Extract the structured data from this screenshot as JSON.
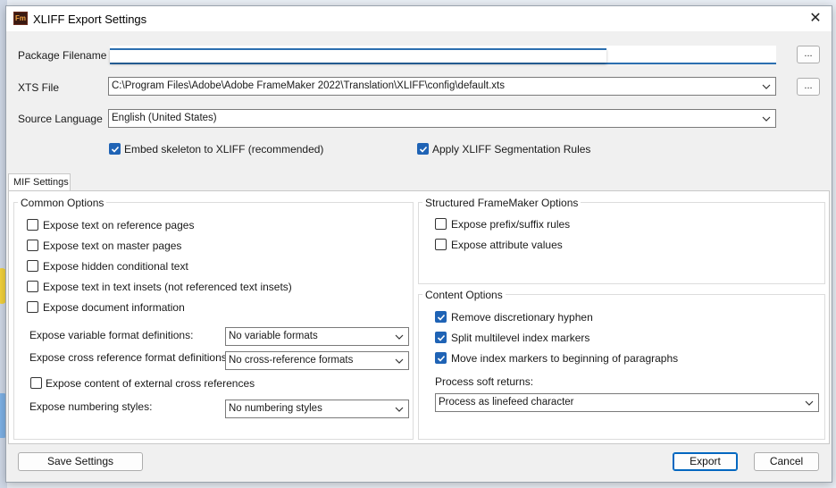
{
  "dialog": {
    "title": "XLIFF Export Settings",
    "app_icon_text": "Fm",
    "close_symbol": "✕"
  },
  "top": {
    "package_label": "Package Filename",
    "package_value": "",
    "xts_label": "XTS File",
    "xts_value": "C:\\Program Files\\Adobe\\Adobe FrameMaker 2022\\Translation\\XLIFF\\config\\default.xts",
    "source_lang_label": "Source Language",
    "source_lang_value": "English (United States)",
    "browse_label": "...",
    "embed_skeleton": {
      "label": "Embed skeleton to XLIFF (recommended)",
      "checked": true
    },
    "apply_segmentation": {
      "label": "Apply XLIFF Segmentation Rules",
      "checked": true
    }
  },
  "tab": {
    "label": "MIF Settings"
  },
  "common_options": {
    "title": "Common Options",
    "checks": [
      {
        "label": "Expose text on reference pages",
        "checked": false
      },
      {
        "label": "Expose text on master pages",
        "checked": false
      },
      {
        "label": "Expose hidden conditional text",
        "checked": false
      },
      {
        "label": "Expose text in text insets (not referenced text insets)",
        "checked": false
      },
      {
        "label": "Expose document information",
        "checked": false
      }
    ],
    "variable_formats_label": "Expose variable format definitions:",
    "variable_formats_value": "No variable formats",
    "xref_formats_label": "Expose cross reference format definitions:",
    "xref_formats_value": "No cross-reference formats",
    "external_xref": {
      "label": "Expose content of external cross references",
      "checked": false
    },
    "numbering_label": "Expose numbering styles:",
    "numbering_value": "No numbering styles"
  },
  "structured_options": {
    "title": "Structured FrameMaker Options",
    "checks": [
      {
        "label": "Expose prefix/suffix rules",
        "checked": false
      },
      {
        "label": "Expose attribute values",
        "checked": false
      }
    ]
  },
  "content_options": {
    "title": "Content Options",
    "checks": [
      {
        "label": "Remove discretionary hyphen",
        "checked": true
      },
      {
        "label": "Split multilevel index markers",
        "checked": true
      },
      {
        "label": "Move index markers to beginning of paragraphs",
        "checked": true
      }
    ],
    "soft_returns_label": "Process soft returns:",
    "soft_returns_value": "Process as linefeed character"
  },
  "footer": {
    "save_label": "Save Settings",
    "export_label": "Export",
    "cancel_label": "Cancel"
  },
  "colors": {
    "accent": "#1f63b5",
    "focus": "#2c6fb0"
  }
}
